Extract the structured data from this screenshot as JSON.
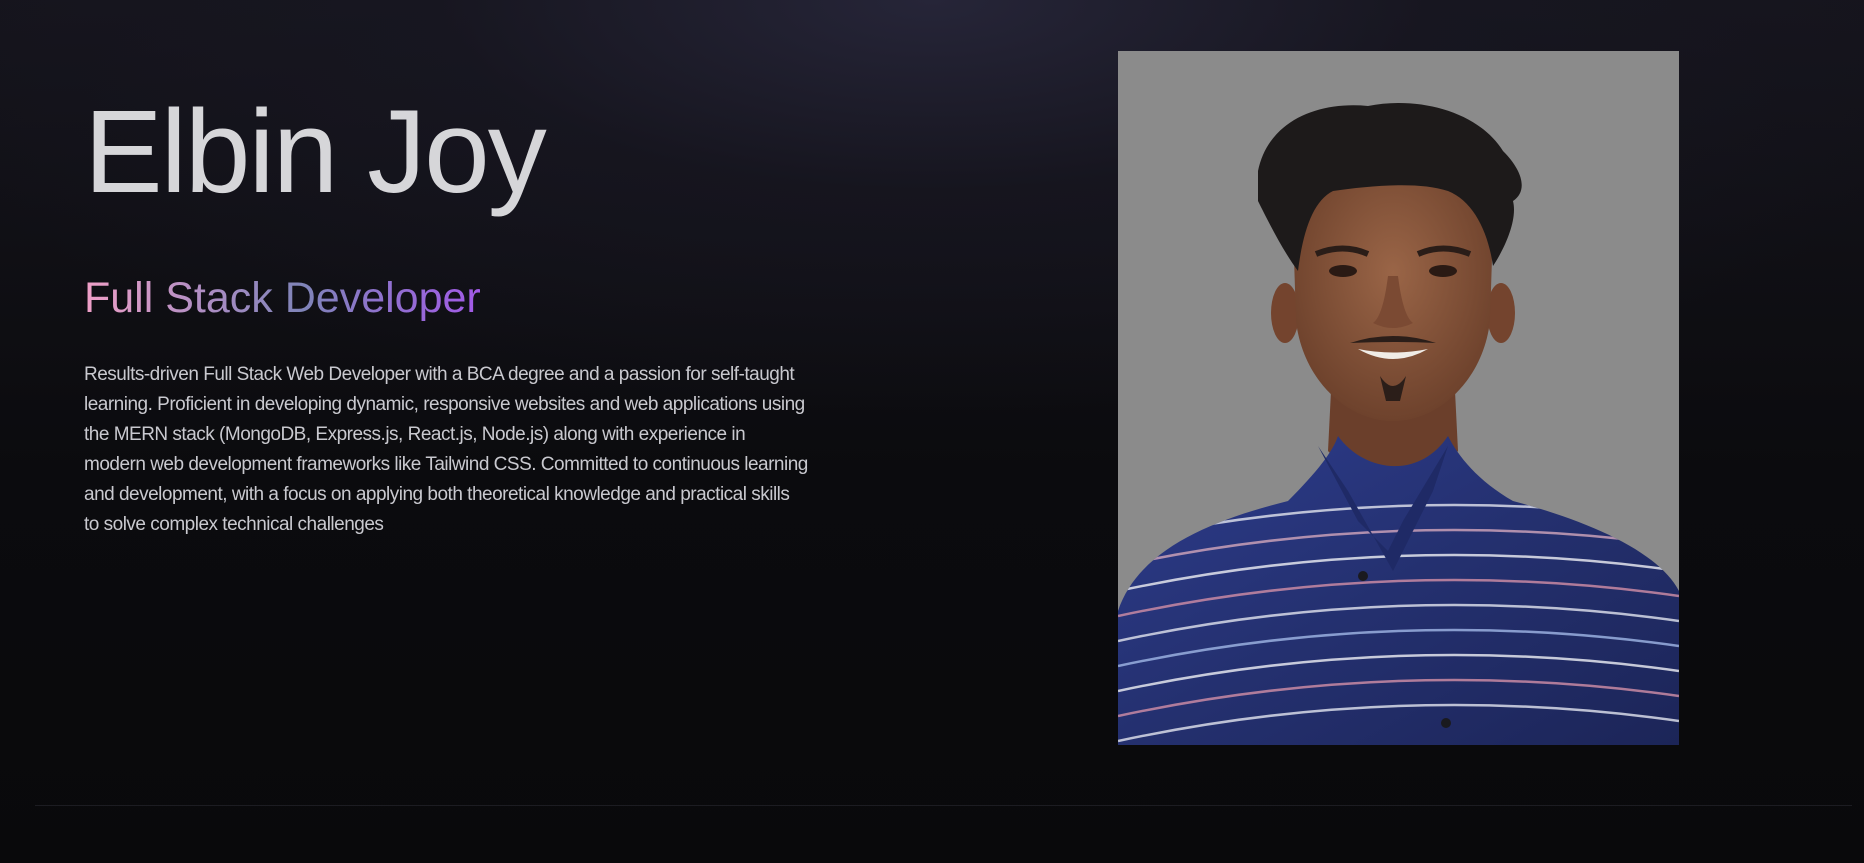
{
  "hero": {
    "name": "Elbin Joy",
    "role": "Full Stack Developer",
    "bio": "Results-driven Full Stack Web Developer with a BCA degree and a passion for self-taught learning. Proficient in developing dynamic, responsive websites and web applications using the MERN stack (MongoDB, Express.js, React.js, Node.js) along with experience in modern web development frameworks like Tailwind CSS. Committed to continuous learning and development, with a focus on applying both theoretical knowledge and practical skills to solve complex technical challenges"
  },
  "colors": {
    "background": "#0b0b0e",
    "name_text": "#d6d6d9",
    "role_gradient_start": "#f0a0c8",
    "role_gradient_end": "#a35ae8",
    "bio_text": "#c9c9cf",
    "photo_backdrop": "#8b8b8b"
  }
}
